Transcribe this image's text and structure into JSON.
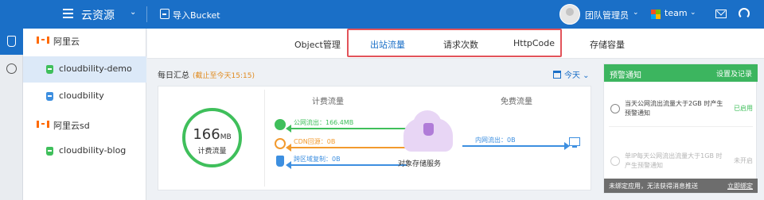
{
  "topbar": {
    "title": "云资源",
    "import_label": "导入Bucket",
    "user_label": "团队管理员",
    "team_label": "team"
  },
  "tree": {
    "groups": [
      {
        "label": "阿里云",
        "buckets": [
          "cloudbility-demo",
          "cloudbility"
        ]
      },
      {
        "label": "阿里云sd",
        "buckets": [
          "cloudbility-blog"
        ]
      }
    ]
  },
  "tabs": [
    "Object管理",
    "出站流量",
    "请求次数",
    "HttpCode",
    "存储容量"
  ],
  "active_tab": "出站流量",
  "summary": {
    "title": "每日汇总",
    "note": "(截止至今天15:15)",
    "period": "今天",
    "total_value": "166",
    "total_unit": "MB",
    "total_label": "计费流量",
    "billed_title": "计费流量",
    "free_title": "免费流量",
    "flows": {
      "public": "公网流出：166.4MB",
      "cdn": "CDN回源：0B",
      "cross_region": "跨区域复制：0B",
      "intranet": "内网流出：0B"
    },
    "oss_label": "对象存储服务"
  },
  "alerts": {
    "title": "预警通知",
    "settings": "设置及记录",
    "items": [
      {
        "text": "当天公网流出流量大于2GB 时产生预警通知",
        "status": "已启用"
      },
      {
        "text": "单IP每天公网流出流量大于1GB 时产生预警通知",
        "status": "未开启"
      }
    ],
    "footer_text": "未绑定应用，无法获得消息推送",
    "footer_link": "立即绑定"
  },
  "colors": {
    "primary": "#1a6fc7",
    "green": "#3fbf5b",
    "orange": "#f29a2e",
    "blue": "#3d8fe0",
    "highlight": "#e2535a"
  }
}
